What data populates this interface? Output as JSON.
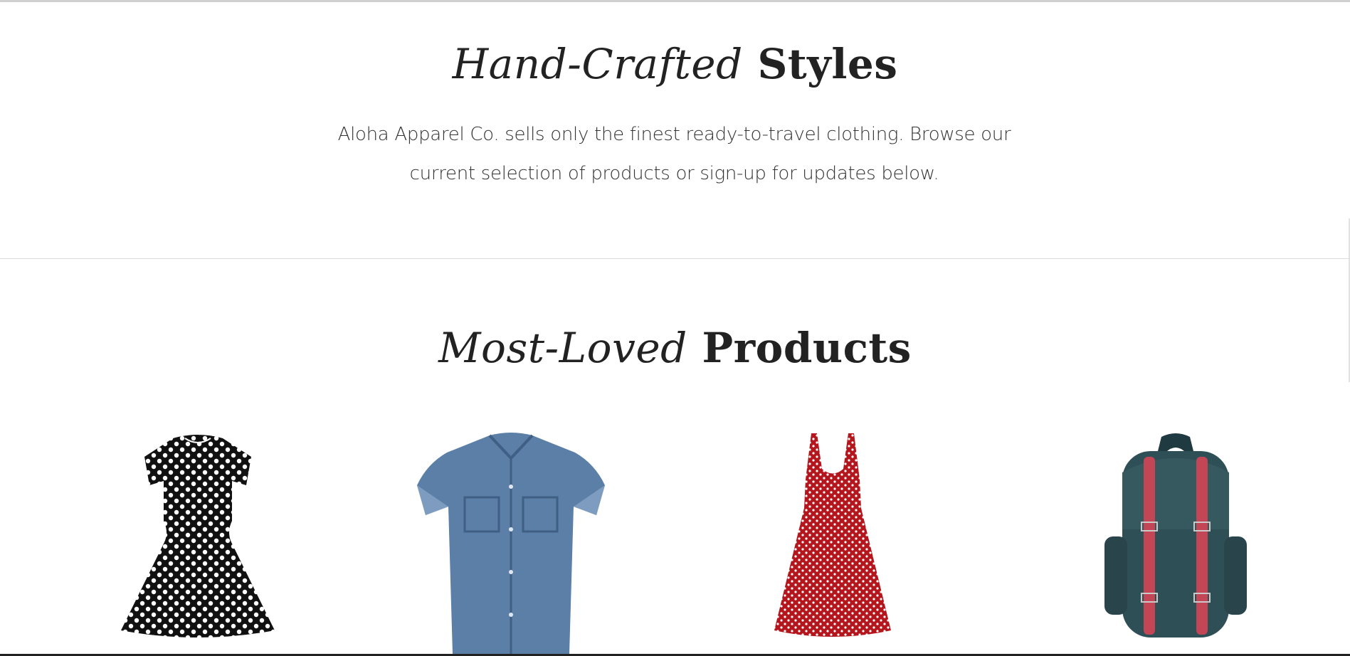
{
  "intro": {
    "title_italic": "Hand-Crafted",
    "title_bold": "Styles",
    "text": "Aloha Apparel Co. sells only the finest ready-to-travel clothing. Browse our current selection of products or sign-up for updates below."
  },
  "products": {
    "title_italic": "Most-Loved",
    "title_bold": "Products",
    "items": [
      {
        "image": "polka-dot-black-dress-image"
      },
      {
        "image": "denim-shirt-image"
      },
      {
        "image": "red-polka-dot-dress-image"
      },
      {
        "image": "teal-backpack-image"
      }
    ]
  },
  "colors": {
    "text": "#222222",
    "body_text": "#333333",
    "divider": "#dcdcdc",
    "denim": "#5b7fa6",
    "red_dress": "#b3161c",
    "backpack": "#2f4f57",
    "strap": "#c24656"
  }
}
